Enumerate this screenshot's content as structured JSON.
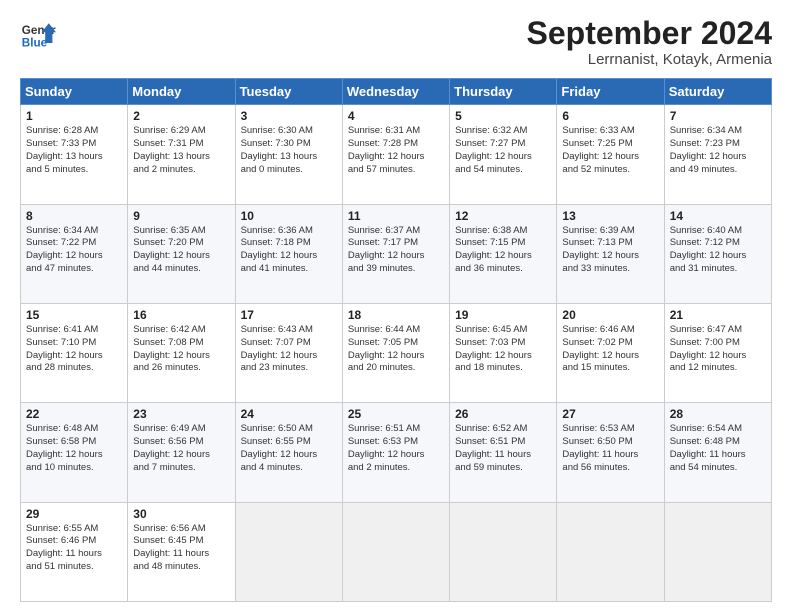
{
  "header": {
    "logo_line1": "General",
    "logo_line2": "Blue",
    "title": "September 2024",
    "subtitle": "Lerrnanist, Kotayk, Armenia"
  },
  "days_of_week": [
    "Sunday",
    "Monday",
    "Tuesday",
    "Wednesday",
    "Thursday",
    "Friday",
    "Saturday"
  ],
  "weeks": [
    [
      {
        "day": "1",
        "lines": [
          "Sunrise: 6:28 AM",
          "Sunset: 7:33 PM",
          "Daylight: 13 hours",
          "and 5 minutes."
        ]
      },
      {
        "day": "2",
        "lines": [
          "Sunrise: 6:29 AM",
          "Sunset: 7:31 PM",
          "Daylight: 13 hours",
          "and 2 minutes."
        ]
      },
      {
        "day": "3",
        "lines": [
          "Sunrise: 6:30 AM",
          "Sunset: 7:30 PM",
          "Daylight: 13 hours",
          "and 0 minutes."
        ]
      },
      {
        "day": "4",
        "lines": [
          "Sunrise: 6:31 AM",
          "Sunset: 7:28 PM",
          "Daylight: 12 hours",
          "and 57 minutes."
        ]
      },
      {
        "day": "5",
        "lines": [
          "Sunrise: 6:32 AM",
          "Sunset: 7:27 PM",
          "Daylight: 12 hours",
          "and 54 minutes."
        ]
      },
      {
        "day": "6",
        "lines": [
          "Sunrise: 6:33 AM",
          "Sunset: 7:25 PM",
          "Daylight: 12 hours",
          "and 52 minutes."
        ]
      },
      {
        "day": "7",
        "lines": [
          "Sunrise: 6:34 AM",
          "Sunset: 7:23 PM",
          "Daylight: 12 hours",
          "and 49 minutes."
        ]
      }
    ],
    [
      {
        "day": "8",
        "lines": [
          "Sunrise: 6:34 AM",
          "Sunset: 7:22 PM",
          "Daylight: 12 hours",
          "and 47 minutes."
        ]
      },
      {
        "day": "9",
        "lines": [
          "Sunrise: 6:35 AM",
          "Sunset: 7:20 PM",
          "Daylight: 12 hours",
          "and 44 minutes."
        ]
      },
      {
        "day": "10",
        "lines": [
          "Sunrise: 6:36 AM",
          "Sunset: 7:18 PM",
          "Daylight: 12 hours",
          "and 41 minutes."
        ]
      },
      {
        "day": "11",
        "lines": [
          "Sunrise: 6:37 AM",
          "Sunset: 7:17 PM",
          "Daylight: 12 hours",
          "and 39 minutes."
        ]
      },
      {
        "day": "12",
        "lines": [
          "Sunrise: 6:38 AM",
          "Sunset: 7:15 PM",
          "Daylight: 12 hours",
          "and 36 minutes."
        ]
      },
      {
        "day": "13",
        "lines": [
          "Sunrise: 6:39 AM",
          "Sunset: 7:13 PM",
          "Daylight: 12 hours",
          "and 33 minutes."
        ]
      },
      {
        "day": "14",
        "lines": [
          "Sunrise: 6:40 AM",
          "Sunset: 7:12 PM",
          "Daylight: 12 hours",
          "and 31 minutes."
        ]
      }
    ],
    [
      {
        "day": "15",
        "lines": [
          "Sunrise: 6:41 AM",
          "Sunset: 7:10 PM",
          "Daylight: 12 hours",
          "and 28 minutes."
        ]
      },
      {
        "day": "16",
        "lines": [
          "Sunrise: 6:42 AM",
          "Sunset: 7:08 PM",
          "Daylight: 12 hours",
          "and 26 minutes."
        ]
      },
      {
        "day": "17",
        "lines": [
          "Sunrise: 6:43 AM",
          "Sunset: 7:07 PM",
          "Daylight: 12 hours",
          "and 23 minutes."
        ]
      },
      {
        "day": "18",
        "lines": [
          "Sunrise: 6:44 AM",
          "Sunset: 7:05 PM",
          "Daylight: 12 hours",
          "and 20 minutes."
        ]
      },
      {
        "day": "19",
        "lines": [
          "Sunrise: 6:45 AM",
          "Sunset: 7:03 PM",
          "Daylight: 12 hours",
          "and 18 minutes."
        ]
      },
      {
        "day": "20",
        "lines": [
          "Sunrise: 6:46 AM",
          "Sunset: 7:02 PM",
          "Daylight: 12 hours",
          "and 15 minutes."
        ]
      },
      {
        "day": "21",
        "lines": [
          "Sunrise: 6:47 AM",
          "Sunset: 7:00 PM",
          "Daylight: 12 hours",
          "and 12 minutes."
        ]
      }
    ],
    [
      {
        "day": "22",
        "lines": [
          "Sunrise: 6:48 AM",
          "Sunset: 6:58 PM",
          "Daylight: 12 hours",
          "and 10 minutes."
        ]
      },
      {
        "day": "23",
        "lines": [
          "Sunrise: 6:49 AM",
          "Sunset: 6:56 PM",
          "Daylight: 12 hours",
          "and 7 minutes."
        ]
      },
      {
        "day": "24",
        "lines": [
          "Sunrise: 6:50 AM",
          "Sunset: 6:55 PM",
          "Daylight: 12 hours",
          "and 4 minutes."
        ]
      },
      {
        "day": "25",
        "lines": [
          "Sunrise: 6:51 AM",
          "Sunset: 6:53 PM",
          "Daylight: 12 hours",
          "and 2 minutes."
        ]
      },
      {
        "day": "26",
        "lines": [
          "Sunrise: 6:52 AM",
          "Sunset: 6:51 PM",
          "Daylight: 11 hours",
          "and 59 minutes."
        ]
      },
      {
        "day": "27",
        "lines": [
          "Sunrise: 6:53 AM",
          "Sunset: 6:50 PM",
          "Daylight: 11 hours",
          "and 56 minutes."
        ]
      },
      {
        "day": "28",
        "lines": [
          "Sunrise: 6:54 AM",
          "Sunset: 6:48 PM",
          "Daylight: 11 hours",
          "and 54 minutes."
        ]
      }
    ],
    [
      {
        "day": "29",
        "lines": [
          "Sunrise: 6:55 AM",
          "Sunset: 6:46 PM",
          "Daylight: 11 hours",
          "and 51 minutes."
        ]
      },
      {
        "day": "30",
        "lines": [
          "Sunrise: 6:56 AM",
          "Sunset: 6:45 PM",
          "Daylight: 11 hours",
          "and 48 minutes."
        ]
      },
      null,
      null,
      null,
      null,
      null
    ]
  ]
}
